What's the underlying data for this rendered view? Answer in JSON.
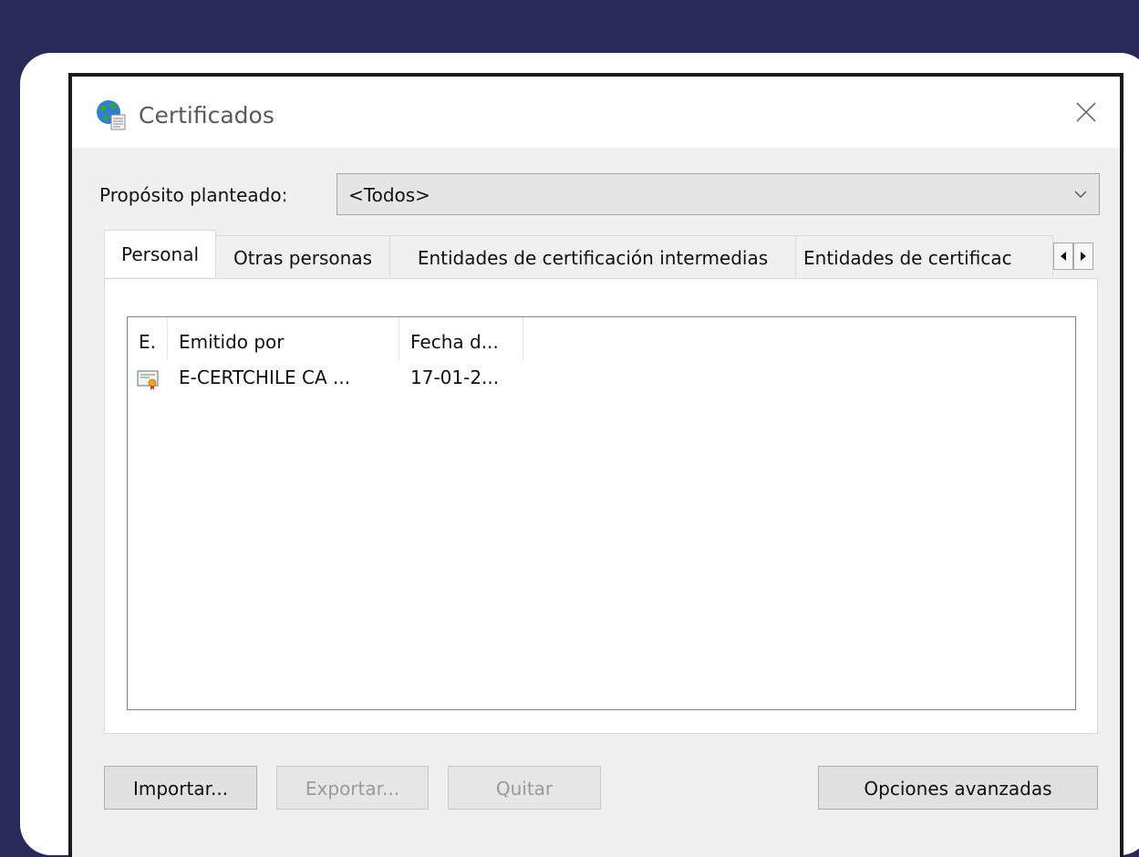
{
  "window": {
    "title": "Certificados",
    "icon": "globe-certificate-icon",
    "close_icon": "close-icon"
  },
  "purpose": {
    "label": "Propósito planteado:",
    "selected": "<Todos>"
  },
  "tabs": [
    {
      "label": "Personal",
      "active": true
    },
    {
      "label": "Otras personas",
      "active": false
    },
    {
      "label": "Entidades de certificación intermedias",
      "active": false
    },
    {
      "label": "Entidades de certificac",
      "active": false
    }
  ],
  "list": {
    "columns": [
      "E.",
      "Emitido por",
      "Fecha d..."
    ],
    "rows": [
      {
        "icon": "certificate-icon",
        "issued_by": "E-CERTCHILE CA ...",
        "date": "17-01-2..."
      }
    ]
  },
  "buttons": {
    "import": "Importar...",
    "export": "Exportar...",
    "remove": "Quitar",
    "advanced": "Opciones avanzadas"
  },
  "colors": {
    "background": "#2a2a5a",
    "card": "#ffffff",
    "window": "#f0f0f0"
  }
}
